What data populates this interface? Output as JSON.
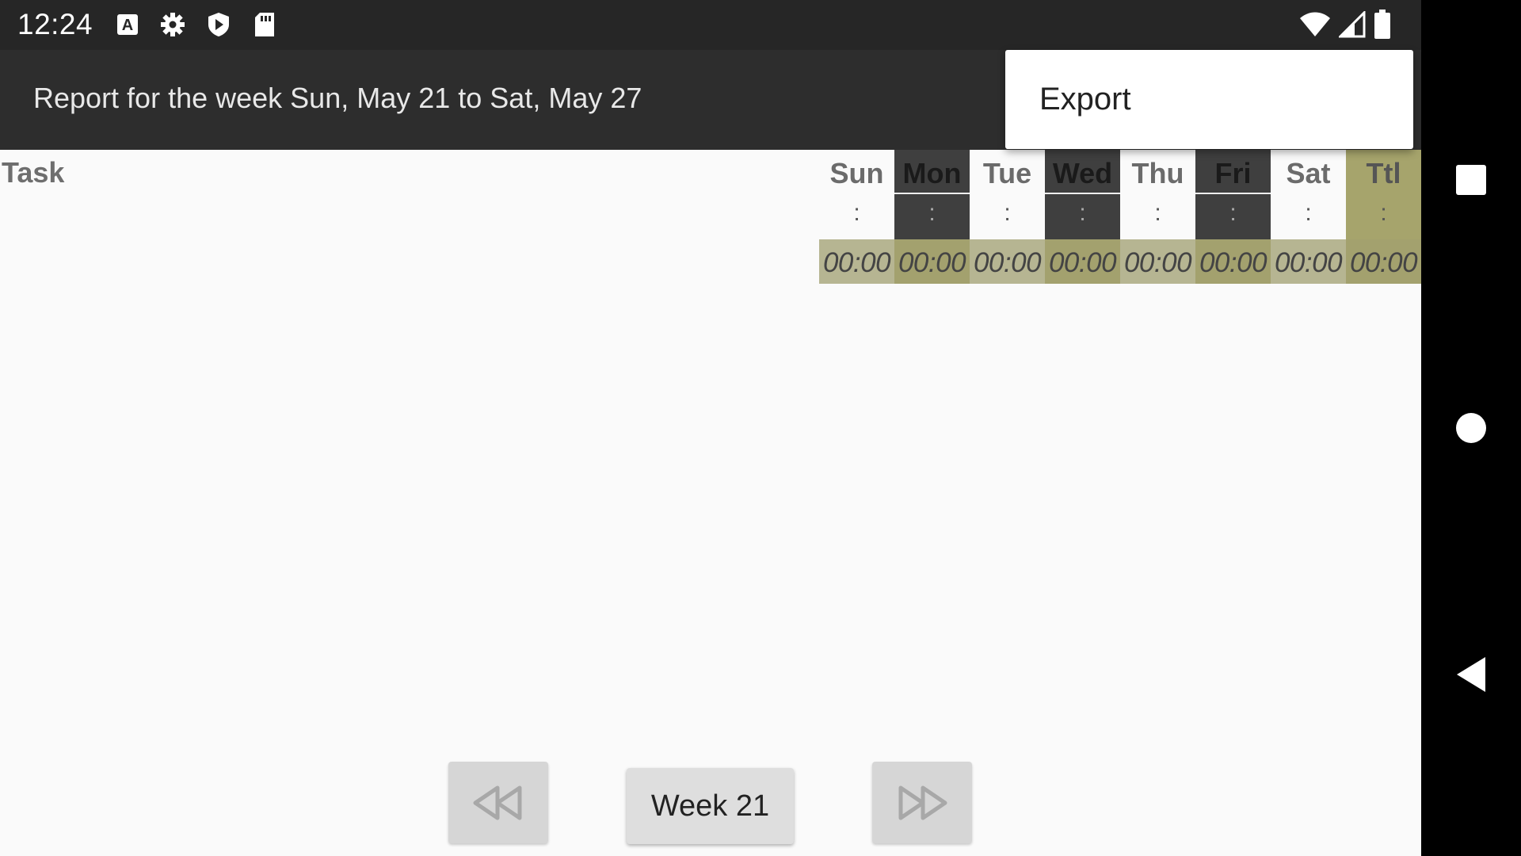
{
  "status_bar": {
    "time": "12:24",
    "left_icons": [
      "font-a-icon",
      "gear-icon",
      "play-shield-icon",
      "sd-card-icon"
    ],
    "right_icons": [
      "wifi-icon",
      "cell-signal-icon",
      "battery-icon"
    ]
  },
  "app_bar": {
    "title": "Report for the week Sun, May 21 to Sat, May 27"
  },
  "menu": {
    "items": [
      {
        "label": "Export"
      }
    ]
  },
  "report": {
    "task_header": "Task",
    "days": [
      {
        "label": "Sun",
        "sep": ":",
        "total": "00:00"
      },
      {
        "label": "Mon",
        "sep": ":",
        "total": "00:00"
      },
      {
        "label": "Tue",
        "sep": ":",
        "total": "00:00"
      },
      {
        "label": "Wed",
        "sep": ":",
        "total": "00:00"
      },
      {
        "label": "Thu",
        "sep": ":",
        "total": "00:00"
      },
      {
        "label": "Fri",
        "sep": ":",
        "total": "00:00"
      },
      {
        "label": "Sat",
        "sep": ":",
        "total": "00:00"
      },
      {
        "label": "Ttl",
        "sep": ":",
        "total": "00:00"
      }
    ]
  },
  "nav": {
    "prev_icon": "rewind-icon",
    "week_label": "Week 21",
    "next_icon": "fast-forward-icon"
  },
  "system_nav": {
    "items": [
      "recents-icon",
      "home-icon",
      "back-icon"
    ]
  }
}
